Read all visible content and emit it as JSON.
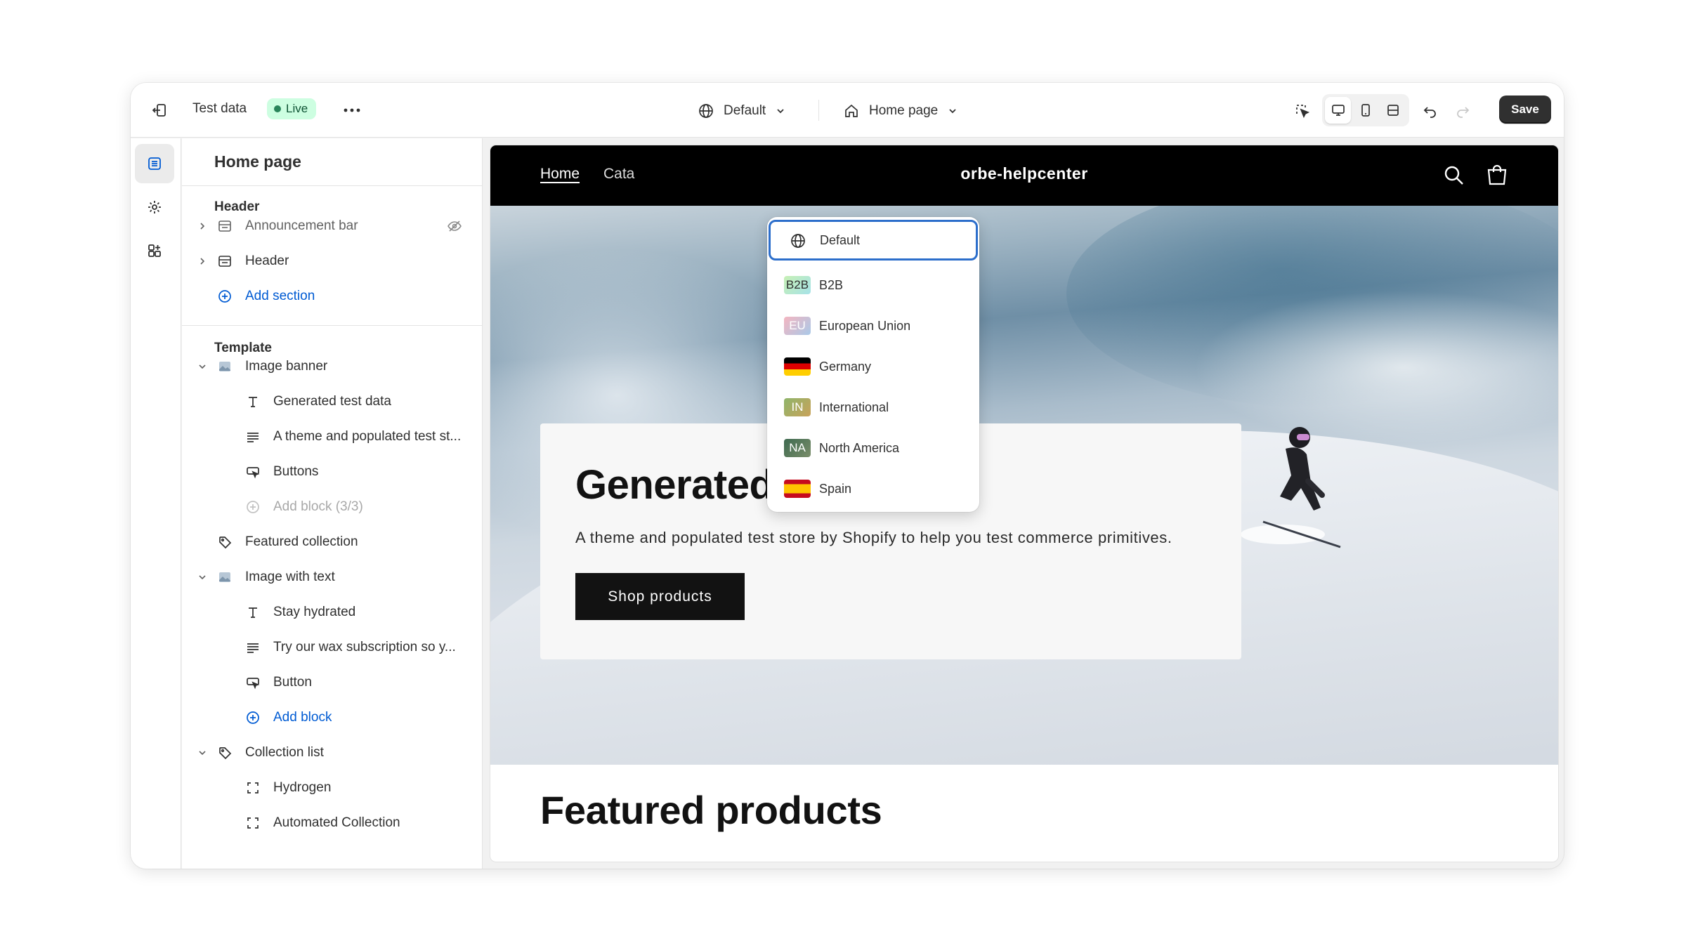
{
  "topbar": {
    "store_title": "Test data",
    "status_badge": "Live",
    "more_icon": "ellipsis-icon",
    "market_selector": "Default",
    "page_selector": "Home page",
    "save_label": "Save"
  },
  "rail": {
    "items": [
      "sections-icon",
      "settings-icon",
      "apps-icon"
    ]
  },
  "sidebar": {
    "title": "Home page",
    "header_group": "Header",
    "header_items": [
      {
        "label": "Announcement bar",
        "icon": "section-icon",
        "hidden": true
      },
      {
        "label": "Header",
        "icon": "section-icon"
      }
    ],
    "header_add": "Add section",
    "template_group": "Template",
    "template_items": [
      {
        "label": "Image banner",
        "level": 1,
        "icon": "image-icon"
      },
      {
        "label": "Generated test data",
        "level": 2,
        "icon": "text-icon"
      },
      {
        "label": "A theme and populated test st...",
        "level": 2,
        "icon": "paragraph-icon"
      },
      {
        "label": "Buttons",
        "level": 2,
        "icon": "button-icon"
      },
      {
        "label": "Add block (3/3)",
        "level": 2,
        "icon": "add-icon"
      },
      {
        "label": "Featured collection",
        "level": 1,
        "icon": "tag-icon"
      },
      {
        "label": "Image with text",
        "level": 1,
        "icon": "image-icon"
      },
      {
        "label": "Stay hydrated",
        "level": 2,
        "icon": "text-icon"
      },
      {
        "label": "Try our wax subscription so y...",
        "level": 2,
        "icon": "paragraph-icon"
      },
      {
        "label": "Button",
        "level": 2,
        "icon": "button-icon"
      },
      {
        "label": "Add block",
        "level": 2,
        "icon": "add-icon"
      },
      {
        "label": "Collection list",
        "level": 1,
        "icon": "tag-icon"
      },
      {
        "label": "Hydrogen",
        "level": 2,
        "icon": "collection-icon"
      },
      {
        "label": "Automated Collection",
        "level": 2,
        "icon": "collection-icon"
      }
    ]
  },
  "store": {
    "nav_home": "Home",
    "nav_catalog": "Cata",
    "name": "orbe-helpcenter",
    "hero_title": "Generated test data",
    "hero_subtitle": "A theme and populated test store by Shopify to help you test commerce primitives.",
    "hero_button": "Shop products",
    "featured_title": "Featured products"
  },
  "market_dropdown": {
    "options": [
      {
        "label": "Default",
        "badge": "",
        "selected": true
      },
      {
        "label": "B2B",
        "badge": "B2B"
      },
      {
        "label": "European Union",
        "badge": "EU"
      },
      {
        "label": "Germany",
        "badge": ""
      },
      {
        "label": "International",
        "badge": "IN"
      },
      {
        "label": "North America",
        "badge": "NA"
      },
      {
        "label": "Spain",
        "badge": ""
      }
    ]
  },
  "colors": {
    "accent": "#005bd3",
    "live_badge_bg": "#cdfee1",
    "save_bg": "#303030",
    "store_nav_bg": "#000000"
  }
}
